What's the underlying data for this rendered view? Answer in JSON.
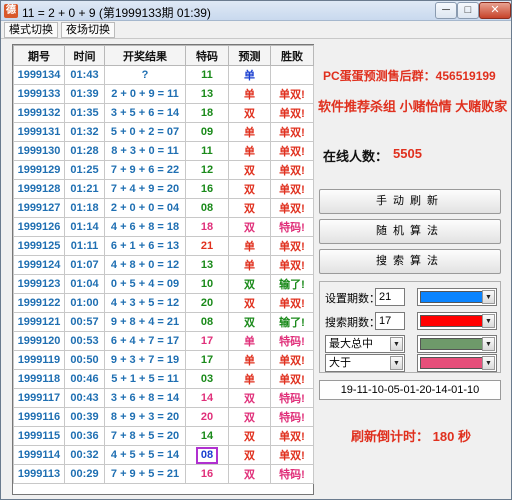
{
  "window": {
    "title": "11 = 2 + 0 + 9 (第1999133期 01:39)",
    "icon_text": "德",
    "min_glyph": "─",
    "max_glyph": "□",
    "close_glyph": "✕"
  },
  "menu": {
    "items": [
      {
        "label": "模式切换"
      },
      {
        "label": "夜场切换"
      }
    ]
  },
  "table": {
    "headers": [
      "期号",
      "时间",
      "开奖结果",
      "特码",
      "预测",
      "胜败"
    ],
    "rows": [
      {
        "id": "1999134",
        "time": "01:43",
        "result": "?",
        "code": "11",
        "code_color": "#1a8a1a",
        "pred": "单",
        "pred_color": "#1a3fd0",
        "outcome": "",
        "outcome_color": "#000000",
        "highlight": false
      },
      {
        "id": "1999133",
        "time": "01:39",
        "result": "2 + 0 + 9 = 11",
        "code": "13",
        "code_color": "#1a8a1a",
        "pred": "单",
        "pred_color": "#e0301e",
        "outcome": "单双!",
        "outcome_color": "#e0301e",
        "highlight": false
      },
      {
        "id": "1999132",
        "time": "01:35",
        "result": "3 + 5 + 6 = 14",
        "code": "18",
        "code_color": "#1a8a1a",
        "pred": "双",
        "pred_color": "#e0301e",
        "outcome": "单双!",
        "outcome_color": "#e0301e",
        "highlight": false
      },
      {
        "id": "1999131",
        "time": "01:32",
        "result": "5 + 0 + 2 = 07",
        "code": "09",
        "code_color": "#1a8a1a",
        "pred": "单",
        "pred_color": "#e0301e",
        "outcome": "单双!",
        "outcome_color": "#e0301e",
        "highlight": false
      },
      {
        "id": "1999130",
        "time": "01:28",
        "result": "8 + 3 + 0 = 11",
        "code": "11",
        "code_color": "#1a8a1a",
        "pred": "单",
        "pred_color": "#e0301e",
        "outcome": "单双!",
        "outcome_color": "#e0301e",
        "highlight": false
      },
      {
        "id": "1999129",
        "time": "01:25",
        "result": "7 + 9 + 6 = 22",
        "code": "12",
        "code_color": "#1a8a1a",
        "pred": "双",
        "pred_color": "#e0301e",
        "outcome": "单双!",
        "outcome_color": "#e0301e",
        "highlight": false
      },
      {
        "id": "1999128",
        "time": "01:21",
        "result": "7 + 4 + 9 = 20",
        "code": "16",
        "code_color": "#1a8a1a",
        "pred": "双",
        "pred_color": "#e0301e",
        "outcome": "单双!",
        "outcome_color": "#e0301e",
        "highlight": false
      },
      {
        "id": "1999127",
        "time": "01:18",
        "result": "2 + 0 + 0 = 04",
        "code": "08",
        "code_color": "#1a8a1a",
        "pred": "双",
        "pred_color": "#e0301e",
        "outcome": "单双!",
        "outcome_color": "#e0301e",
        "highlight": false
      },
      {
        "id": "1999126",
        "time": "01:14",
        "result": "4 + 6 + 8 = 18",
        "code": "18",
        "code_color": "#e0307a",
        "pred": "双",
        "pred_color": "#e0307a",
        "outcome": "特码!",
        "outcome_color": "#e0307a",
        "highlight": false
      },
      {
        "id": "1999125",
        "time": "01:11",
        "result": "6 + 1 + 6 = 13",
        "code": "21",
        "code_color": "#e0301e",
        "pred": "单",
        "pred_color": "#e0301e",
        "outcome": "单双!",
        "outcome_color": "#e0301e",
        "highlight": false
      },
      {
        "id": "1999124",
        "time": "01:07",
        "result": "4 + 8 + 0 = 12",
        "code": "13",
        "code_color": "#1a8a1a",
        "pred": "单",
        "pred_color": "#e0301e",
        "outcome": "单双!",
        "outcome_color": "#e0301e",
        "highlight": false
      },
      {
        "id": "1999123",
        "time": "01:04",
        "result": "0 + 5 + 4 = 09",
        "code": "10",
        "code_color": "#1a8a1a",
        "pred": "双",
        "pred_color": "#1a8a1a",
        "outcome": "输了!",
        "outcome_color": "#1a8a1a",
        "highlight": false
      },
      {
        "id": "1999122",
        "time": "01:00",
        "result": "4 + 3 + 5 = 12",
        "code": "20",
        "code_color": "#1a8a1a",
        "pred": "双",
        "pred_color": "#e0301e",
        "outcome": "单双!",
        "outcome_color": "#e0301e",
        "highlight": false
      },
      {
        "id": "1999121",
        "time": "00:57",
        "result": "9 + 8 + 4 = 21",
        "code": "08",
        "code_color": "#1a8a1a",
        "pred": "双",
        "pred_color": "#1a8a1a",
        "outcome": "输了!",
        "outcome_color": "#1a8a1a",
        "highlight": false
      },
      {
        "id": "1999120",
        "time": "00:53",
        "result": "6 + 4 + 7 = 17",
        "code": "17",
        "code_color": "#e0307a",
        "pred": "单",
        "pred_color": "#e0307a",
        "outcome": "特码!",
        "outcome_color": "#e0307a",
        "highlight": false
      },
      {
        "id": "1999119",
        "time": "00:50",
        "result": "9 + 3 + 7 = 19",
        "code": "17",
        "code_color": "#1a8a1a",
        "pred": "单",
        "pred_color": "#e0301e",
        "outcome": "单双!",
        "outcome_color": "#e0301e",
        "highlight": false
      },
      {
        "id": "1999118",
        "time": "00:46",
        "result": "5 + 1 + 5 = 11",
        "code": "03",
        "code_color": "#1a8a1a",
        "pred": "单",
        "pred_color": "#e0301e",
        "outcome": "单双!",
        "outcome_color": "#e0301e",
        "highlight": false
      },
      {
        "id": "1999117",
        "time": "00:43",
        "result": "3 + 6 + 8 = 14",
        "code": "14",
        "code_color": "#e0307a",
        "pred": "双",
        "pred_color": "#e0307a",
        "outcome": "特码!",
        "outcome_color": "#e0307a",
        "highlight": false
      },
      {
        "id": "1999116",
        "time": "00:39",
        "result": "8 + 9 + 3 = 20",
        "code": "20",
        "code_color": "#e0307a",
        "pred": "双",
        "pred_color": "#e0307a",
        "outcome": "特码!",
        "outcome_color": "#e0307a",
        "highlight": false
      },
      {
        "id": "1999115",
        "time": "00:36",
        "result": "7 + 8 + 5 = 20",
        "code": "14",
        "code_color": "#1a8a1a",
        "pred": "双",
        "pred_color": "#e0301e",
        "outcome": "单双!",
        "outcome_color": "#e0301e",
        "highlight": false
      },
      {
        "id": "1999114",
        "time": "00:32",
        "result": "4 + 5 + 5 = 14",
        "code": "08",
        "code_color": "#1a3fd0",
        "pred": "双",
        "pred_color": "#e0301e",
        "outcome": "单双!",
        "outcome_color": "#e0301e",
        "highlight": true
      },
      {
        "id": "1999113",
        "time": "00:29",
        "result": "7 + 9 + 5 = 21",
        "code": "16",
        "code_color": "#e0307a",
        "pred": "双",
        "pred_color": "#e0307a",
        "outcome": "特码!",
        "outcome_color": "#e0307a",
        "highlight": false
      }
    ]
  },
  "panel": {
    "contact": "PC蛋蛋预测售后群：456519199",
    "slogan": "软件推荐杀组 小赌怡情 大赌败家",
    "online_label": "在线人数：",
    "online_value": "5505",
    "buttons": {
      "manual_refresh": "手动刷新",
      "random_algo": "随机算法",
      "search_algo": "搜索算法"
    },
    "settings": {
      "period_label": "设置期数：",
      "period_value": "21",
      "period_color": "#0a84ff",
      "search_label": "搜索期数：",
      "search_value": "17",
      "search_color": "#ff0000",
      "mode_value": "最大总中",
      "mode_color": "#6e9a6a",
      "compare_value": "大于",
      "compare_color": "#e64f7a"
    },
    "sequence": "19-11-10-05-01-20-14-01-10",
    "countdown_label": "刷新倒计时：",
    "countdown_value": "180",
    "countdown_unit": "秒"
  }
}
